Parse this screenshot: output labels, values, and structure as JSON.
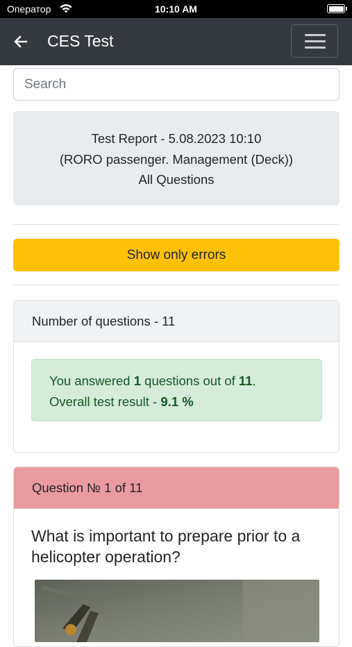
{
  "status_bar": {
    "carrier": "Оператор",
    "time": "10:10 AM"
  },
  "navbar": {
    "title": "CES Test"
  },
  "search": {
    "placeholder": "Search"
  },
  "report": {
    "line1": "Test Report - 5.08.2023 10:10",
    "line2": "(RORO passenger. Management (Deck))",
    "line3": "All Questions"
  },
  "filter": {
    "show_errors_label": "Show only errors"
  },
  "summary": {
    "header": "Number of questions - 11",
    "answered_prefix": "You answered ",
    "answered_count": "1",
    "answered_mid": " questions out of ",
    "total": "11",
    "answered_suffix": ".",
    "result_prefix": "Overall test result - ",
    "result_value": "9.1 %"
  },
  "question": {
    "header": "Question № 1 of 11",
    "text": "What is important to prepare prior to a helicopter operation?"
  },
  "colors": {
    "navbar": "#343a40",
    "warning": "#ffc107",
    "success_bg": "#d4edda",
    "success_text": "#155724",
    "danger_header": "#eb9a9f"
  }
}
